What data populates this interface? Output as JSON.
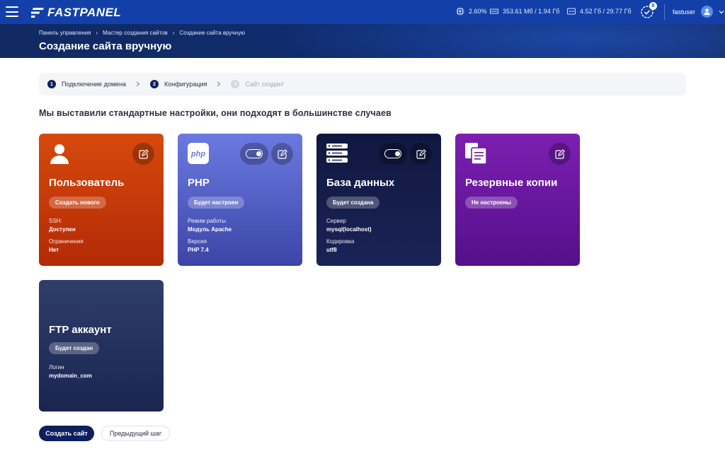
{
  "app": {
    "logo_text": "FASTPANEL"
  },
  "topbar": {
    "cpu": "2.60%",
    "memory": "353.61 Мб / 1.94 Гб",
    "disk": "4.52 Гб / 29.77 Гб",
    "notifications_count": "0",
    "username": "fastuser"
  },
  "breadcrumb": [
    "Панель управления",
    "Мастер создания сайтов",
    "Создание сайта вручную"
  ],
  "page_title": "Создание сайта вручную",
  "stepper": {
    "steps": [
      {
        "num": "1",
        "label": "Подключение домена",
        "state": "done"
      },
      {
        "num": "2",
        "label": "Конфигурация",
        "state": "active"
      },
      {
        "num": "3",
        "label": "Сайт создан!",
        "state": "pending"
      }
    ]
  },
  "subtitle": "Мы выставили стандартные настройки, они подходят в большинстве случаев",
  "cards": {
    "user": {
      "title": "Пользователь",
      "badge": "Создать нового",
      "icon": "user-icon",
      "fields": [
        {
          "key": "SSH:",
          "value": "Доступен"
        },
        {
          "key": "Ограничения",
          "value": "Нет"
        }
      ]
    },
    "php": {
      "title": "PHP",
      "badge": "Будет настроен",
      "icon": "php-icon",
      "icon_text": "php",
      "toggle_on": true,
      "fields": [
        {
          "key": "Режим работы",
          "value": "Модуль Apache"
        },
        {
          "key": "Версия",
          "value": "PHP 7.4"
        }
      ]
    },
    "database": {
      "title": "База данных",
      "badge": "Будет создана",
      "icon": "server-icon",
      "toggle_on": true,
      "fields": [
        {
          "key": "Сервер",
          "value": "mysql(localhost)"
        },
        {
          "key": "Кодировка",
          "value": "utf8"
        }
      ]
    },
    "backup": {
      "title": "Резервные копии",
      "badge": "Не настроены",
      "icon": "documents-icon"
    },
    "ftp": {
      "title": "FTP аккаунт",
      "badge": "Будет создан",
      "fields": [
        {
          "key": "Логин",
          "value": "mydomain_com"
        }
      ]
    }
  },
  "actions": {
    "create_site": "Создать сайт",
    "previous_step": "Предыдущий шаг"
  },
  "colors": {
    "topbar": "#1340a8",
    "primary_dark": "#0e1f5c",
    "card_user": "#c83a08",
    "card_php": "#5563c8",
    "card_db": "#141c48",
    "card_backup": "#6a179e",
    "card_ftp": "#26325e"
  }
}
